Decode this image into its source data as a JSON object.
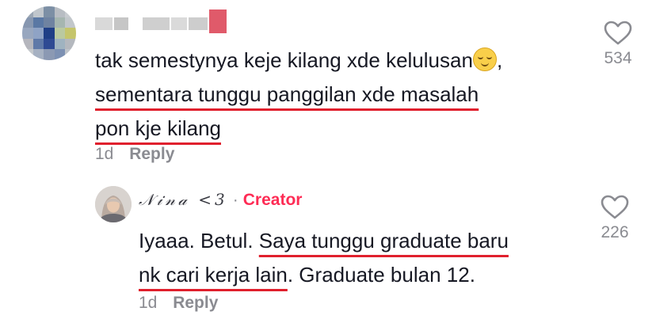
{
  "comment": {
    "avatar_icon": "pixelated-avatar-icon",
    "text_plain": "tak semestynya keje kilang xde kelulusan",
    "text_tail": ",",
    "text_line2": "sementara tunggu panggilan xde masalah",
    "text_line3": "pon kje kilang",
    "age": "1d",
    "reply_label": "Reply",
    "likes": "534"
  },
  "reply": {
    "author": "𝒩𝒾𝓃𝒶 <3",
    "separator": "·",
    "badge": "Creator",
    "text_plain": "Iyaaa. Betul.",
    "text_ul1": "Saya tunggu graduate baru",
    "text_ul2": "nk cari kerja lain",
    "text_tail": ". Graduate bulan 12.",
    "age": "1d",
    "reply_label": "Reply",
    "likes": "226"
  },
  "colors": {
    "underline": "#e0202d",
    "creator": "#fe2c55",
    "muted": "#8a8b91"
  }
}
